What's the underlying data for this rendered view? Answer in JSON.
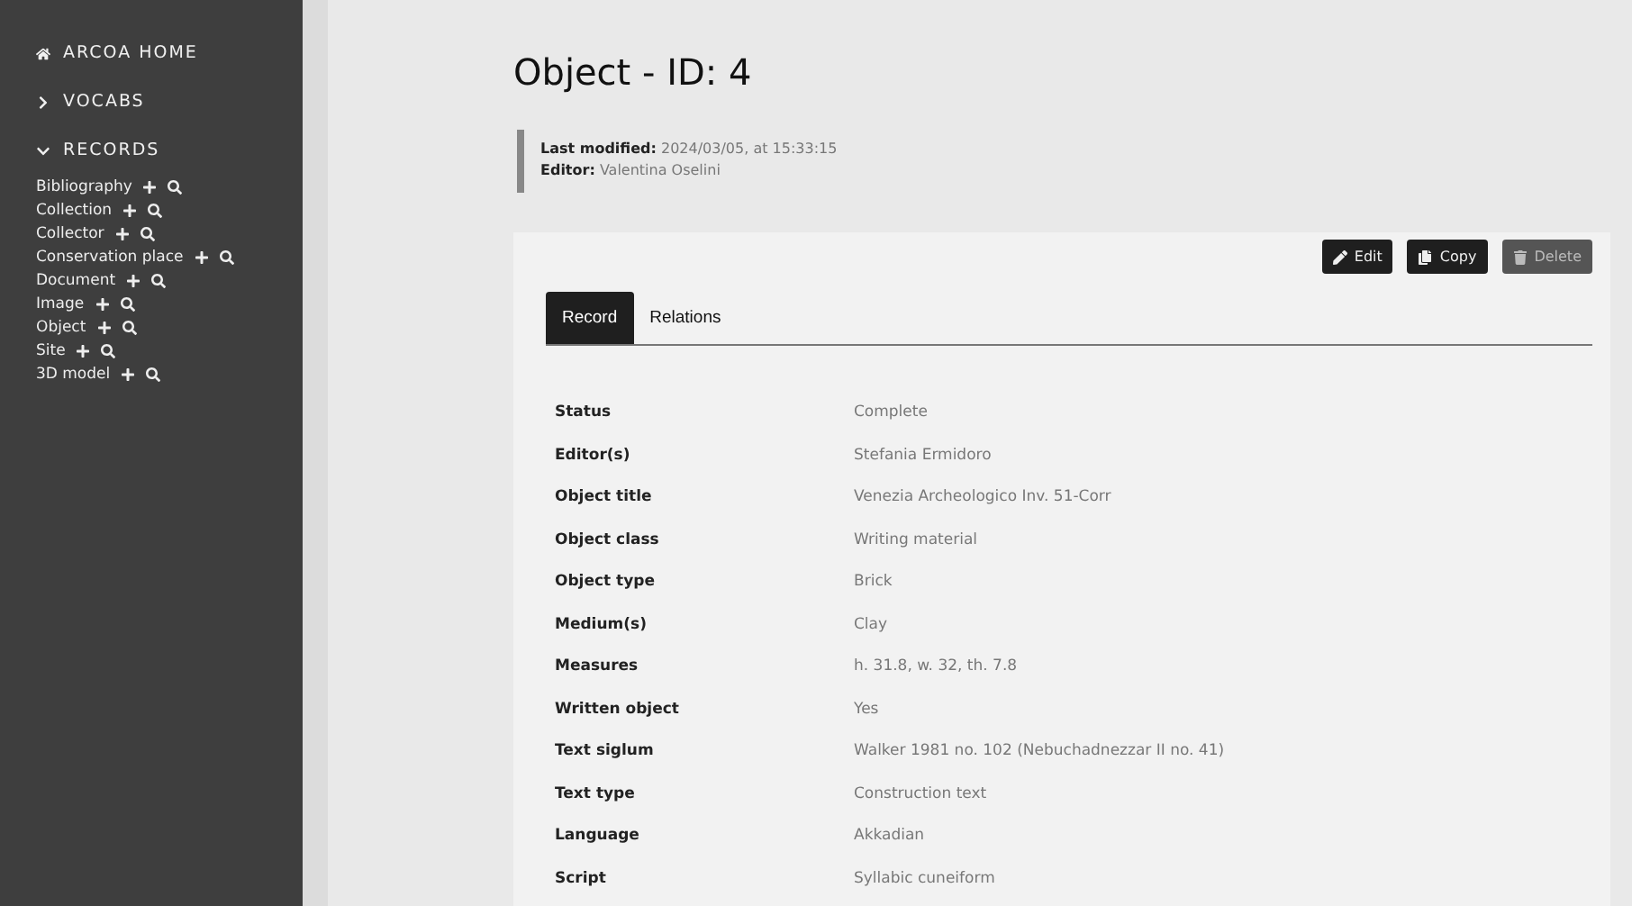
{
  "sidebar": {
    "home": "ARCOA HOME",
    "sections": [
      {
        "label": "VOCABS",
        "expanded": false
      },
      {
        "label": "RECORDS",
        "expanded": true,
        "items": [
          "Bibliography",
          "Collection",
          "Collector",
          "Conservation place",
          "Document",
          "Image",
          "Object",
          "Site",
          "3D model"
        ]
      }
    ]
  },
  "title": "Object - ID: 4",
  "meta": [
    {
      "label": "Last modified:",
      "value": "2024/03/05, at 15:33:15"
    },
    {
      "label": "Editor:",
      "value": "Valentina Oselini"
    }
  ],
  "actions": [
    {
      "kind": "edit",
      "label": "Edit",
      "disabled": false
    },
    {
      "kind": "copy",
      "label": "Copy",
      "disabled": false
    },
    {
      "kind": "delete",
      "label": "Delete",
      "disabled": true
    }
  ],
  "tabs": [
    {
      "label": "Record",
      "selected": true
    },
    {
      "label": "Relations",
      "selected": false
    }
  ],
  "fields": [
    {
      "label": "Status",
      "value": "Complete"
    },
    {
      "label": "Editor(s)",
      "value": "Stefania Ermidoro"
    },
    {
      "label": "Object title",
      "value": "Venezia Archeologico Inv. 51-Corr"
    },
    {
      "label": "Object class",
      "value": "Writing material"
    },
    {
      "label": "Object type",
      "value": "Brick"
    },
    {
      "label": "Medium(s)",
      "value": "Clay"
    },
    {
      "label": "Measures",
      "value": "h. 31.8, w. 32, th. 7.8"
    },
    {
      "label": "Written object",
      "value": "Yes"
    },
    {
      "label": "Text siglum",
      "value": "Walker 1981 no. 102 (Nebuchadnezzar II no. 41)"
    },
    {
      "label": "Text type",
      "value": "Construction text"
    },
    {
      "label": "Language",
      "value": "Akkadian"
    },
    {
      "label": "Script",
      "value": "Syllabic cuneiform"
    }
  ]
}
